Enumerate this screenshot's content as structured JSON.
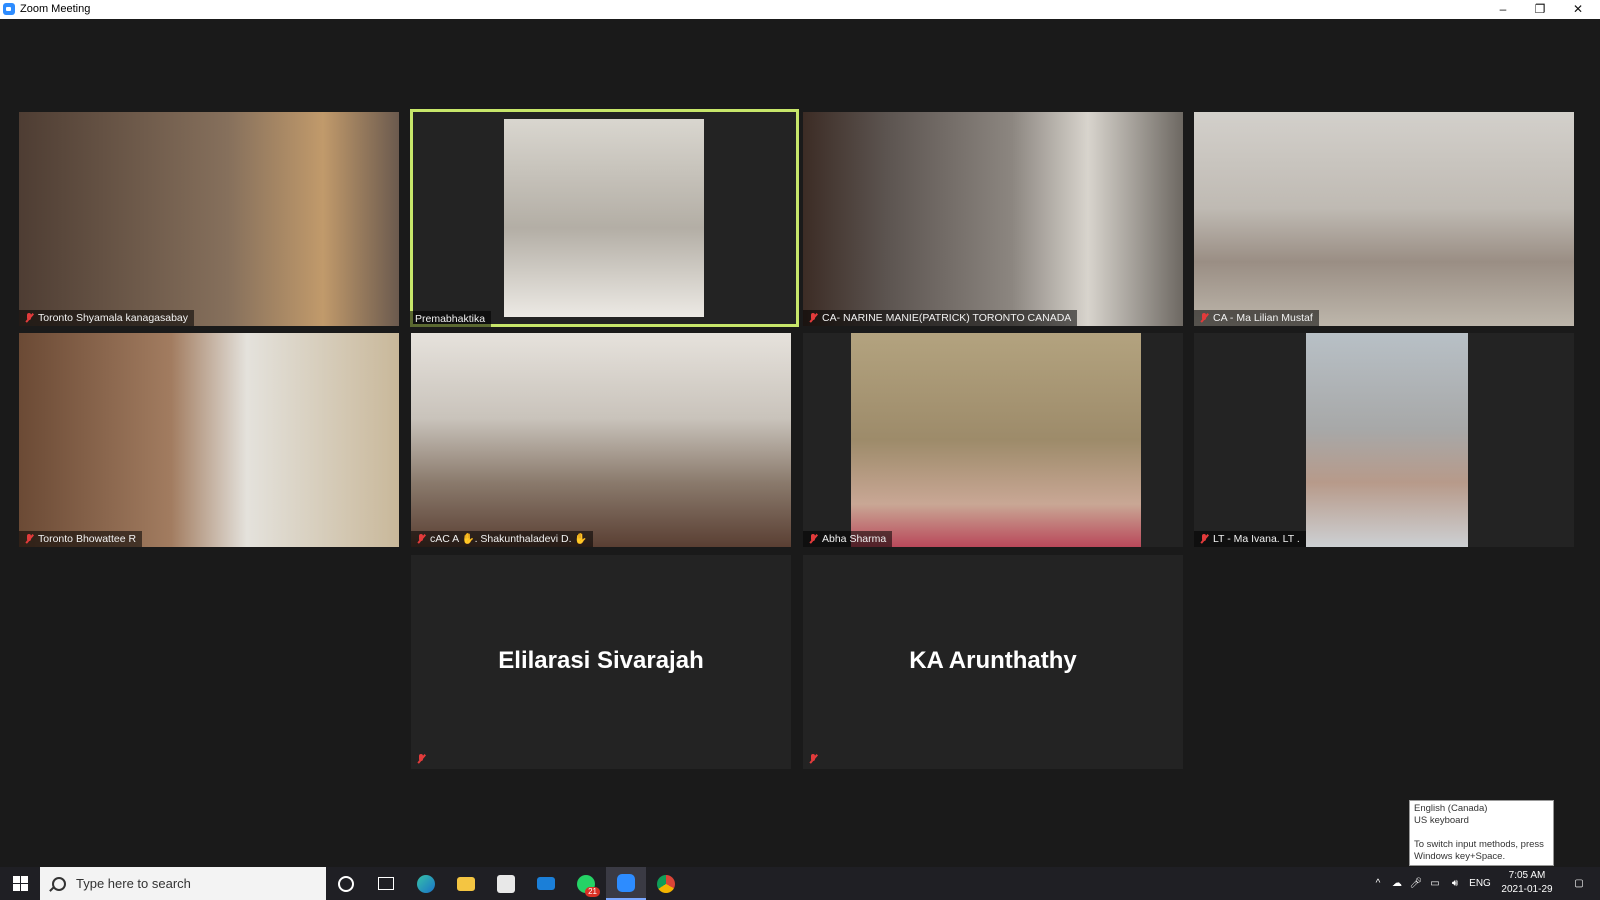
{
  "window": {
    "title": "Zoom Meeting",
    "controls": {
      "minimize": "–",
      "restore": "❐",
      "close": "✕"
    }
  },
  "gallery": {
    "active_speaker": "Premabhaktika",
    "participants": [
      {
        "name": "Toronto  Shyamala  kanagasabay",
        "muted": true,
        "video": true,
        "bg": "#6f5a4b"
      },
      {
        "name": "Premabhaktika",
        "muted": false,
        "video": true,
        "active": true,
        "bg": "#b9b4ab"
      },
      {
        "name": "CA- NARINE MANIE(PATRICK) TORONTO CANADA",
        "muted": true,
        "video": true,
        "bg": "#7c7670"
      },
      {
        "name": "CA - Ma Lilian Mustaf",
        "muted": true,
        "video": true,
        "bg": "#c4bfb8"
      },
      {
        "name": "Toronto  Bhowattee R",
        "muted": true,
        "video": true,
        "bg": "#8a6f55"
      },
      {
        "name": "cAC A ✋. Shakunthaladevi D.  ✋",
        "muted": true,
        "video": true,
        "bg": "#9a8d80"
      },
      {
        "name": "Abha Sharma",
        "muted": true,
        "video": true,
        "bg": "#9d8b6a"
      },
      {
        "name": "LT - Ma Ivana. LT .",
        "muted": true,
        "video": true,
        "bg": "#a8b0b8"
      },
      {
        "name": "Elilarasi Sivarajah",
        "muted": true,
        "video": false
      },
      {
        "name": "KA Arunthathy",
        "muted": true,
        "video": false
      }
    ]
  },
  "language_tooltip": {
    "line1": "English (Canada)",
    "line2": "US keyboard",
    "line3": "To switch input methods, press",
    "line4": "Windows key+Space."
  },
  "taskbar": {
    "search_placeholder": "Type here to search",
    "apps": [
      "cortana-icon",
      "task-view-icon",
      "edge-icon",
      "file-explorer-icon",
      "store-icon",
      "mail-icon",
      "whatsapp-icon",
      "zoom-icon",
      "chrome-icon"
    ],
    "whatsapp_badge": "21",
    "lang": "ENG",
    "time": "7:05 AM",
    "date": "2021-01-29"
  }
}
